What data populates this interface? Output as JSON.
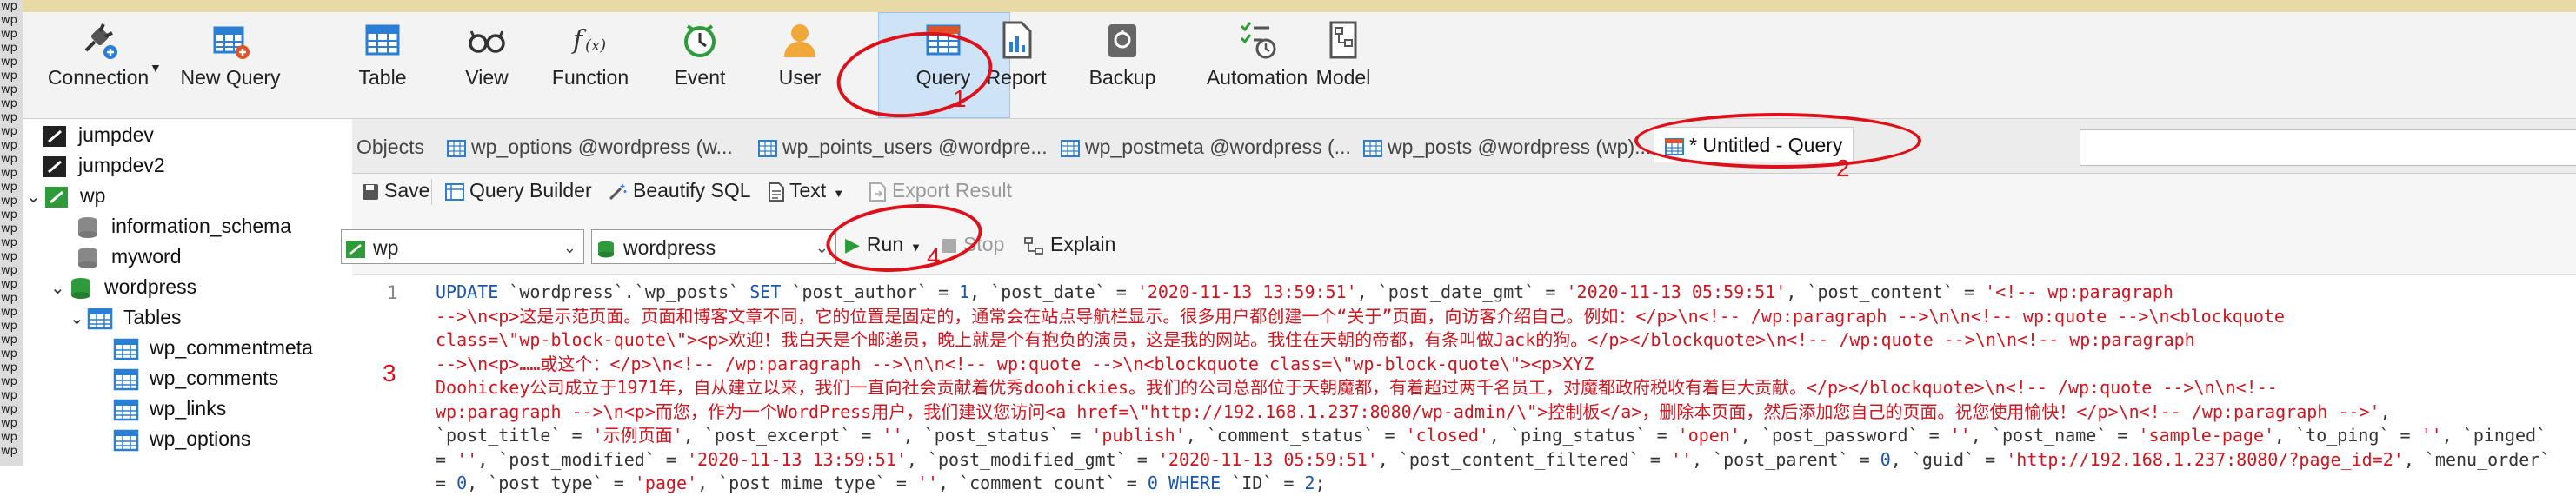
{
  "gutter": [
    "wp",
    "wp",
    "wp",
    "wp",
    "wp",
    "wp",
    "wp",
    "wp",
    "wp",
    "wp",
    "wp",
    "wp",
    "wp",
    "wp",
    "wp",
    "wp",
    "wp",
    "wp",
    "wp",
    "wp",
    "wp",
    "wp",
    "wp",
    "wp",
    "wp",
    "wp",
    "wp",
    "wp",
    "wp",
    "wp",
    "wp",
    "wp",
    "wp"
  ],
  "toolbar": {
    "connection": "Connection",
    "new_query": "New Query",
    "table": "Table",
    "view": "View",
    "function": "Function",
    "event": "Event",
    "user": "User",
    "query": "Query",
    "report": "Report",
    "backup": "Backup",
    "automation": "Automation",
    "model": "Model"
  },
  "sidebar": {
    "items": [
      "jumpdev",
      "jumpdev2",
      "wp",
      "information_schema",
      "myword",
      "wordpress",
      "Tables",
      "wp_commentmeta",
      "wp_comments",
      "wp_links",
      "wp_options"
    ]
  },
  "tabs": {
    "objects": "Objects",
    "t1": "wp_options @wordpress (w...",
    "t2": "wp_points_users @wordpre...",
    "t3": "wp_postmeta @wordpress (...",
    "t4": "wp_posts @wordpress (wp)...",
    "active": "* Untitled - Query"
  },
  "qtoolbar": {
    "save": "Save",
    "query_builder": "Query Builder",
    "beautify": "Beautify SQL",
    "text": "Text",
    "export": "Export Result"
  },
  "selectors": {
    "connection": "wp",
    "database": "wordpress",
    "run": "Run",
    "stop": "Stop",
    "explain": "Explain"
  },
  "editor": {
    "line_number": "1",
    "lines": [
      [
        [
          "k",
          "UPDATE "
        ],
        [
          "t",
          "`wordpress`.`wp_posts` "
        ],
        [
          "k",
          "SET "
        ],
        [
          "t",
          "`post_author` = "
        ],
        [
          "n",
          "1"
        ],
        [
          "t",
          ", `post_date` = "
        ],
        [
          "s",
          "'2020-11-13 13:59:51'"
        ],
        [
          "t",
          ", `post_date_gmt` = "
        ],
        [
          "s",
          "'2020-11-13 05:59:51'"
        ],
        [
          "t",
          ", `post_content` = "
        ],
        [
          "s",
          "'<!-- wp:paragraph"
        ]
      ],
      [
        [
          "s",
          "-->\\n<p>这是示范页面。页面和博客文章不同，它的位置是固定的，通常会在站点导航栏显示。很多用户都创建一个“关于”页面，向访客介绍自己。例如：</p>\\n<!-- /wp:paragraph -->\\n\\n<!-- wp:quote -->\\n<blockquote"
        ]
      ],
      [
        [
          "s",
          "class=\\\"wp-block-quote\\\"><p>欢迎！我白天是个邮递员，晚上就是个有抱负的演员，这是我的网站。我住在天朝的帝都，有条叫做Jack的狗。</p></blockquote>\\n<!-- /wp:quote -->\\n\\n<!-- wp:paragraph"
        ]
      ],
      [
        [
          "s",
          "-->\\n<p>……或这个：</p>\\n<!-- /wp:paragraph -->\\n\\n<!-- wp:quote -->\\n<blockquote class=\\\"wp-block-quote\\\"><p>XYZ"
        ]
      ],
      [
        [
          "s",
          "Doohickey公司成立于1971年，自从建立以来，我们一直向社会贡献着优秀doohickies。我们的公司总部位于天朝魔都，有着超过两千名员工，对魔都政府税收有着巨大贡献。</p></blockquote>\\n<!-- /wp:quote -->\\n\\n<!--"
        ]
      ],
      [
        [
          "s",
          "wp:paragraph -->\\n<p>而您，作为一个WordPress用户，我们建议您访问<a href=\\\"http://192.168.1.237:8080/wp-admin/\\\">控制板</a>，删除本页面，然后添加您自己的页面。祝您使用愉快！</p>\\n<!-- /wp:paragraph -->'"
        ],
        [
          "t",
          ","
        ]
      ],
      [
        [
          "t",
          "`post_title` = "
        ],
        [
          "s",
          "'示例页面'"
        ],
        [
          "t",
          ", `post_excerpt` = "
        ],
        [
          "s",
          "''"
        ],
        [
          "t",
          ", `post_status` = "
        ],
        [
          "s",
          "'publish'"
        ],
        [
          "t",
          ", `comment_status` = "
        ],
        [
          "s",
          "'closed'"
        ],
        [
          "t",
          ", `ping_status` = "
        ],
        [
          "s",
          "'open'"
        ],
        [
          "t",
          ", `post_password` = "
        ],
        [
          "s",
          "''"
        ],
        [
          "t",
          ", `post_name` = "
        ],
        [
          "s",
          "'sample-page'"
        ],
        [
          "t",
          ", `to_ping` = "
        ],
        [
          "s",
          "''"
        ],
        [
          "t",
          ", `pinged`"
        ]
      ],
      [
        [
          "t",
          "= "
        ],
        [
          "s",
          "''"
        ],
        [
          "t",
          ", `post_modified` = "
        ],
        [
          "s",
          "'2020-11-13 13:59:51'"
        ],
        [
          "t",
          ", `post_modified_gmt` = "
        ],
        [
          "s",
          "'2020-11-13 05:59:51'"
        ],
        [
          "t",
          ", `post_content_filtered` = "
        ],
        [
          "s",
          "''"
        ],
        [
          "t",
          ", `post_parent` = "
        ],
        [
          "n",
          "0"
        ],
        [
          "t",
          ", `guid` = "
        ],
        [
          "s",
          "'http://192.168.1.237:8080/?page_id=2'"
        ],
        [
          "t",
          ", `menu_order`"
        ]
      ],
      [
        [
          "t",
          "= "
        ],
        [
          "n",
          "0"
        ],
        [
          "t",
          ", `post_type` = "
        ],
        [
          "s",
          "'page'"
        ],
        [
          "t",
          ", `post_mime_type` = "
        ],
        [
          "s",
          "''"
        ],
        [
          "t",
          ", `comment_count` = "
        ],
        [
          "n",
          "0"
        ],
        [
          "t",
          " "
        ],
        [
          "k",
          "WHERE "
        ],
        [
          "t",
          "`ID` = "
        ],
        [
          "n",
          "2"
        ],
        [
          "t",
          ";"
        ]
      ]
    ]
  },
  "annotations": {
    "n1": "1",
    "n2": "2",
    "n3": "3",
    "n4": "4"
  },
  "colors": {
    "accent": "#e0101a",
    "keyword": "#1a55b0",
    "string": "#d0161f",
    "active_tab": "#cfe3f7"
  }
}
